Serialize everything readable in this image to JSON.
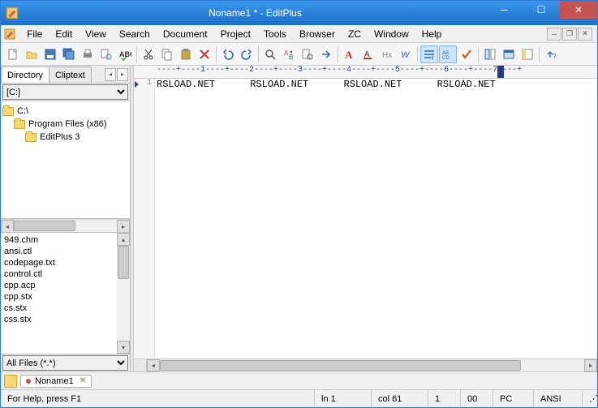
{
  "title": "Noname1 * - EditPlus",
  "menus": [
    "File",
    "Edit",
    "View",
    "Search",
    "Document",
    "Project",
    "Tools",
    "Browser",
    "ZC",
    "Window",
    "Help"
  ],
  "toolbar_icons": [
    "new-file",
    "open-file",
    "save",
    "save-all",
    "print",
    "print-preview",
    "spell-check",
    "",
    "cut",
    "copy",
    "paste",
    "delete",
    "",
    "undo",
    "redo",
    "",
    "find",
    "find-replace",
    "find-in-files",
    "goto",
    "",
    "font-bold",
    "font-color",
    "highlight",
    "strike",
    "",
    "word-wrap",
    "show-codes",
    "check",
    "",
    "column-select",
    "browser-preview",
    "toggle-panel",
    "",
    "help"
  ],
  "toolbar_active": [
    26,
    27
  ],
  "side": {
    "tabs": [
      "Directory",
      "Cliptext"
    ],
    "active_tab": 0,
    "drive": "[C:]",
    "tree": [
      {
        "label": "C:\\",
        "indent": 0
      },
      {
        "label": "Program Files (x86)",
        "indent": 1
      },
      {
        "label": "EditPlus 3",
        "indent": 2
      }
    ],
    "files": [
      "949.chm",
      "ansi.ctl",
      "codepage.txt",
      "control.ctl",
      "cpp.acp",
      "cpp.stx",
      "cs.stx",
      "css.stx"
    ],
    "filter": "All Files (*.*)"
  },
  "ruler": "----+----1----+----2----+----3----+----4----+----5----+----6----+----7----+",
  "ruler_caret_col": 61,
  "editor": {
    "line_no": "1",
    "content": "RSLOAD.NET      RSLOAD.NET      RSLOAD.NET      RSLOAD.NET"
  },
  "doc_tab": {
    "label": "Noname1",
    "modified": true
  },
  "status": {
    "help": "For Help, press F1",
    "line": "ln 1",
    "col": "col 61",
    "num": "1",
    "ovr": "00",
    "mode": "PC",
    "enc": "ANSI"
  }
}
